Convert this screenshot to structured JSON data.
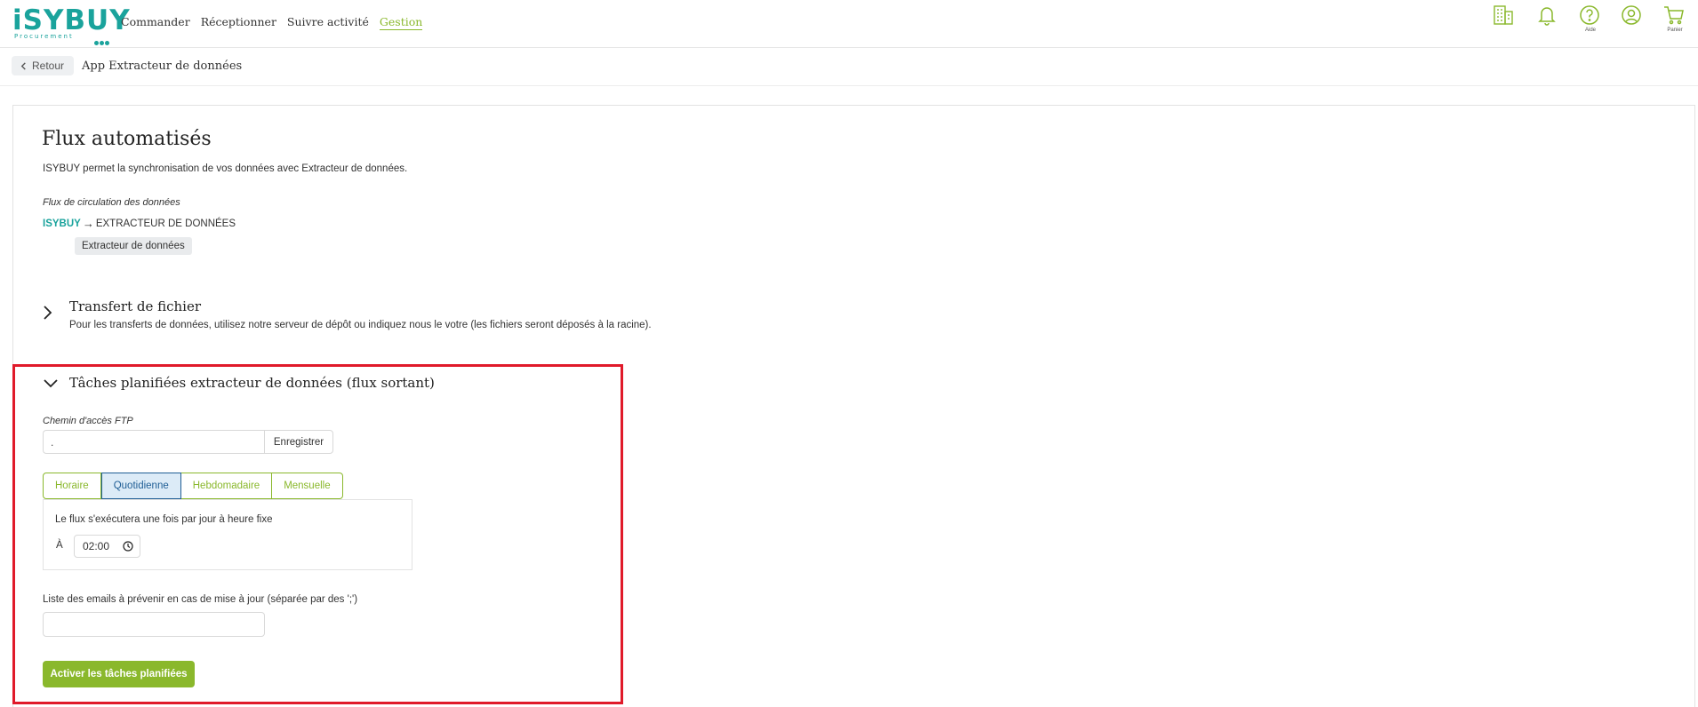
{
  "brand": {
    "logo_text": "iSYBUY",
    "logo_sub": "Procurement",
    "accent_green": "#8ab82c",
    "brand_teal": "#1aa39c",
    "highlight_red": "#e01a2a"
  },
  "nav": {
    "items": [
      {
        "label": "Commander",
        "active": false
      },
      {
        "label": "Réceptionner",
        "active": false
      },
      {
        "label": "Suivre activité",
        "active": false
      },
      {
        "label": "Gestion",
        "active": true
      }
    ]
  },
  "top_icons": [
    {
      "name": "buildings-icon",
      "label": ""
    },
    {
      "name": "bell-icon",
      "label": ""
    },
    {
      "name": "help-icon",
      "label": "Aide"
    },
    {
      "name": "account-icon",
      "label": ""
    },
    {
      "name": "cart-icon",
      "label": "Panier"
    }
  ],
  "subheader": {
    "back_label": "Retour",
    "title": "App Extracteur de données"
  },
  "page": {
    "heading": "Flux automatisés",
    "intro": "ISYBUY permet la synchronisation de vos données avec Extracteur de données.",
    "flow_caption": "Flux de circulation des données",
    "flow_source": "ISYBUY",
    "flow_arrow": "→",
    "flow_target": "EXTRACTEUR DE DONNÉES",
    "tag": "Extracteur de données"
  },
  "file_transfer": {
    "title": "Transfert de fichier",
    "description": "Pour les transferts de données, utilisez notre serveur de dépôt ou indiquez nous le votre (les fichiers seront déposés à la racine).",
    "expanded": false
  },
  "scheduled_tasks": {
    "title": "Tâches planifiées extracteur de données (flux sortant)",
    "expanded": true,
    "ftp_label": "Chemin d'accès FTP",
    "ftp_value": ".",
    "save_label": "Enregistrer",
    "tabs": [
      {
        "label": "Horaire",
        "active": false
      },
      {
        "label": "Quotidienne",
        "active": true
      },
      {
        "label": "Hebdomadaire",
        "active": false
      },
      {
        "label": "Mensuelle",
        "active": false
      }
    ],
    "panel_text": "Le flux s'exécutera une fois par jour à heure fixe",
    "at_label": "À",
    "time_value": "02:00",
    "email_label": "Liste des emails à prévenir en cas de mise à jour (séparée par des ';')",
    "email_value": "",
    "activate_label": "Activer les tâches planifiées"
  }
}
